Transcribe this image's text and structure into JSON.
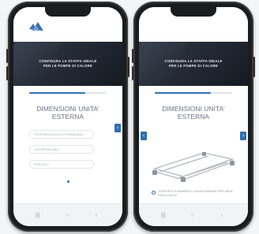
{
  "left_phone": {
    "logo_text": "",
    "banner_title": "CONFIGURA LA STAFFA IDEALE\nPER LE POMPE DI CALORE",
    "progress": 0.72,
    "heading": "DIMENSIONI UNITA'\nESTERNA",
    "fields": [
      {
        "placeholder": "PROFONDITÀ UNITÀ ESTERNA (MM)"
      },
      {
        "placeholder": "LARGHEZZA (MM)"
      },
      {
        "placeholder": "PESO (KG)"
      }
    ],
    "next_label": "›",
    "nav": [
      "|||",
      "○",
      "‹"
    ]
  },
  "right_phone": {
    "banner_title": "CONFIGURA LA STAFFA IDEALE\nPER LE POMPE DI CALORE",
    "progress": 0.72,
    "heading": "DIMENSIONI UNITA'\nESTERNA",
    "prev_label": "‹",
    "next_label": "›",
    "option_text": "SUPPORTO A PAVIMENTO CON ANTIVIBRANTI PER UNITA' FINO A 150 KG",
    "nav": [
      "|||",
      "○",
      "‹"
    ]
  },
  "colors": {
    "accent": "#2f6fb2",
    "banner": "#1d242d"
  }
}
